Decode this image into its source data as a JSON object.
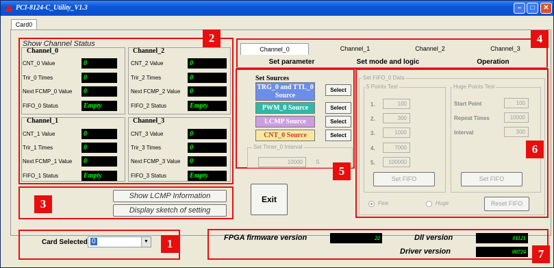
{
  "window": {
    "title": "PCI-8124-C_Utility_V1.3"
  },
  "card_tab": "Card0",
  "channel_status": {
    "title": "Show Channel Status",
    "channels": [
      {
        "name": "Channel_0",
        "cnt_label": "CNT_0 Value",
        "cnt_value": "0",
        "trir_label": "Trir_0 Times",
        "trir_value": "0",
        "fcmp_label": "Next FCMP_0 Value",
        "fcmp_value": "0",
        "fifo_label": "FIFO_0 Status",
        "fifo_value": "Empty"
      },
      {
        "name": "Channel_2",
        "cnt_label": "CNT_2 Value",
        "cnt_value": "0",
        "trir_label": "Trir_2 Times",
        "trir_value": "0",
        "fcmp_label": "Next FCMP_2 Value",
        "fcmp_value": "0",
        "fifo_label": "FIFO_2 Status",
        "fifo_value": "Empty"
      },
      {
        "name": "Channel_1",
        "cnt_label": "CNT_1 Value",
        "cnt_value": "0",
        "trir_label": "Trir_1 Times",
        "trir_value": "0",
        "fcmp_label": "Next FCMP_1 Value",
        "fcmp_value": "0",
        "fifo_label": "FIFO_1 Status",
        "fifo_value": "Empty"
      },
      {
        "name": "Channel_3",
        "cnt_label": "CNT_3 Value",
        "cnt_value": "0",
        "trir_label": "Trir_3 Times",
        "trir_value": "0",
        "fcmp_label": "Next FCMP_3 Value",
        "fcmp_value": "0",
        "fifo_label": "FIFO_3 Status",
        "fifo_value": "Empty"
      }
    ]
  },
  "buttons": {
    "show_lcmp": "Show  LCMP  Information",
    "display_sketch": "Display sketch  of  setting",
    "exit": "Exit"
  },
  "card_selected": {
    "label": "Card Selected",
    "value": "0"
  },
  "channel_tabs": [
    "Channel_0",
    "Channel_1",
    "Channel_2",
    "Channel_3"
  ],
  "mode_tabs": [
    "Set parameter",
    "Set mode and logic",
    "Operation"
  ],
  "set_sources": {
    "title": "Set Sources",
    "sources": [
      {
        "label": "TRG_0 and TTL_0 Source",
        "button": "Select",
        "bg": "#6b8ee8",
        "fg": "#ffffff"
      },
      {
        "label": "PWM_0 Source",
        "button": "Select",
        "bg": "#2fb9a9",
        "fg": "#ffffff"
      },
      {
        "label": "LCMP Source",
        "button": "Select",
        "bg": "#cc9ee0",
        "fg": "#ffffff"
      },
      {
        "label": "CNT_0 Source",
        "button": "Select",
        "bg": "#f6e8a0",
        "fg": "#d33a2a"
      }
    ],
    "timer_group": "Set Timer_0 Interval",
    "timer_value": "10000",
    "timer_button": "S"
  },
  "fifo": {
    "group": "Set FIFO_0 Data",
    "five_points_title": "5 Points Test",
    "points": [
      {
        "label": "1.",
        "value": "100"
      },
      {
        "label": "2.",
        "value": "300"
      },
      {
        "label": "3.",
        "value": "1000"
      },
      {
        "label": "4.",
        "value": "7000"
      },
      {
        "label": "5.",
        "value": "100000"
      }
    ],
    "five_set_button": "Set FIFO",
    "huge_title": "Huge Points Test",
    "start_label": "Start Point",
    "start_value": "100",
    "repeat_label": "Repeat Times",
    "repeat_value": "10000",
    "interval_label": "Interval",
    "interval_value": "300",
    "huge_set_button": "Set FIFO",
    "radio_few": "Few",
    "radio_huge": "Huge",
    "reset_button": "Reset FIFO"
  },
  "versions": {
    "fpga_label": "FPGA firmware version",
    "fpga_value": "22",
    "dll_label": "Dll version",
    "dll_value": "01121",
    "driver_label": "Driver version",
    "driver_value": "00724"
  },
  "callouts": [
    "1",
    "2",
    "3",
    "4",
    "5",
    "6",
    "7"
  ],
  "colors": {
    "callout": "#e80e0e",
    "display_bg": "#000000",
    "display_text": "#00ff00"
  }
}
